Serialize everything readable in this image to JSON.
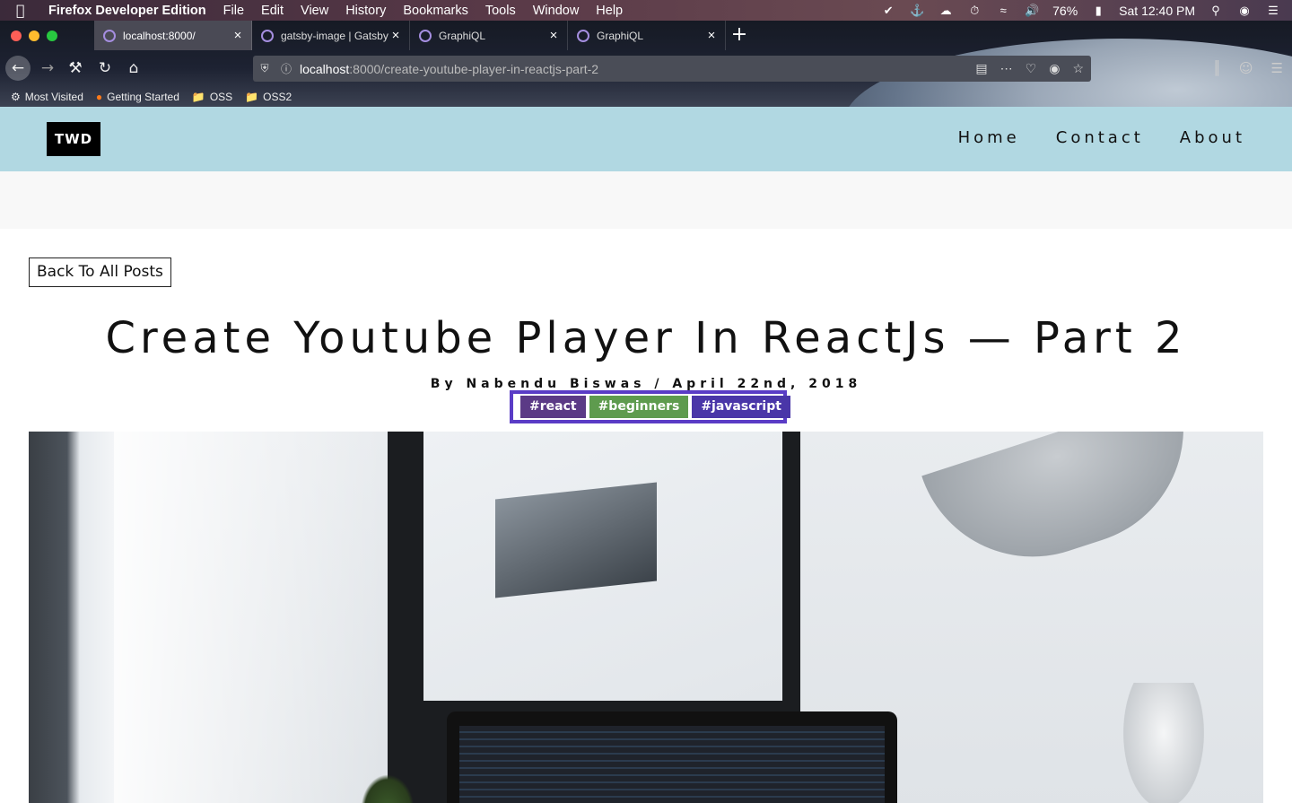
{
  "menubar": {
    "app_name": "Firefox Developer Edition",
    "items": [
      "File",
      "Edit",
      "View",
      "History",
      "Bookmarks",
      "Tools",
      "Window",
      "Help"
    ],
    "battery": "76%",
    "clock": "Sat 12:40 PM",
    "status_icons": [
      "todo-icon",
      "docker-icon",
      "creative-cloud-icon",
      "time-machine-icon",
      "wifi-icon",
      "volume-icon",
      "battery-icon",
      "spotlight-icon",
      "siri-icon",
      "notification-center-icon"
    ]
  },
  "browser": {
    "tabs": [
      {
        "title": "localhost:8000/",
        "active": true
      },
      {
        "title": "gatsby-image | Gatsby",
        "active": false
      },
      {
        "title": "GraphiQL",
        "active": false
      },
      {
        "title": "GraphiQL",
        "active": false
      }
    ],
    "url_host": "localhost",
    "url_rest": ":8000/create-youtube-player-in-reactjs-part-2",
    "bookmarks": [
      "Most Visited",
      "Getting Started",
      "OSS",
      "OSS2"
    ]
  },
  "site": {
    "logo": "TWD",
    "nav": [
      "Home",
      "Contact",
      "About"
    ]
  },
  "post": {
    "back_label": "Back To All Posts",
    "title": "Create Youtube Player In ReactJs — Part 2",
    "byline": "By Nabendu Biswas / April 22nd, 2018",
    "tags": [
      {
        "label": "#react",
        "color": "#5b3a86"
      },
      {
        "label": "#beginners",
        "color": "#5e9b4e"
      },
      {
        "label": "#javascript",
        "color": "#4a36a8"
      }
    ],
    "tags_border_color": "#5a3cc6"
  },
  "colors": {
    "header_bg": "#b1d8e2",
    "band_bg": "#f8f8f8"
  }
}
